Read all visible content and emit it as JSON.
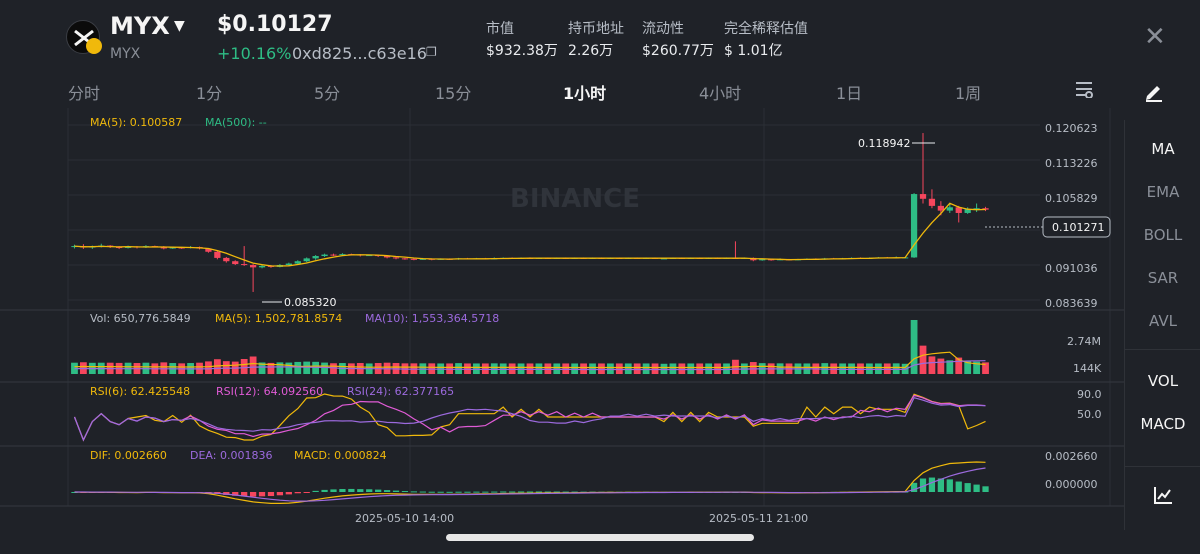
{
  "header": {
    "symbol": "MYX",
    "symbol_sub": "MYX",
    "price": "$0.10127",
    "change": "+10.16%",
    "address": "0xd825...c63e16",
    "stats": [
      {
        "label": "市值",
        "value": "$932.38万"
      },
      {
        "label": "持币地址",
        "value": "2.26万"
      },
      {
        "label": "流动性",
        "value": "$260.77万"
      },
      {
        "label": "完全稀释估值",
        "value": "$ 1.01亿"
      }
    ],
    "close_icon": "close-icon",
    "caret_icon": "chevron-down-icon",
    "copy_icon": "copy-icon"
  },
  "tabs": [
    "分时",
    "1分",
    "5分",
    "15分",
    "1小时",
    "4小时",
    "1日",
    "1周"
  ],
  "active_tab": "1小时",
  "sidebar": [
    "MA",
    "EMA",
    "BOLL",
    "SAR",
    "AVL",
    "VOL",
    "MACD"
  ],
  "sidebar_active": [
    "MA",
    "VOL",
    "MACD"
  ],
  "chart_data": {
    "type": "candlestick",
    "watermark": "BINANCE",
    "price_axis": [
      "0.120623",
      "0.113226",
      "0.105829",
      "0.101271",
      "0.091036",
      "0.083639"
    ],
    "current_price": "0.101271",
    "high_label": "0.118942",
    "low_label": "0.085320",
    "ma_legend": {
      "ma5": "MA(5): 0.100587",
      "ma500": "MA(500): --"
    },
    "vol_legend": {
      "vol": "Vol: 650,776.5849",
      "ma5": "MA(5): 1,502,781.8574",
      "ma10": "MA(10): 1,553,364.5718"
    },
    "vol_axis": [
      "2.74M",
      "144K"
    ],
    "rsi_legend": {
      "r6": "RSI(6): 62.425548",
      "r12": "RSI(12): 64.092560",
      "r24": "RSI(24): 62.377165"
    },
    "rsi_axis": [
      "90.0",
      "50.0"
    ],
    "macd_legend": {
      "dif": "DIF: 0.002660",
      "dea": "DEA: 0.001836",
      "macd": "MACD: 0.000824"
    },
    "macd_axis": [
      "0.002660",
      "0.000000"
    ],
    "x_labels": [
      "2025-05-10 14:00",
      "2025-05-11 21:00"
    ],
    "colors": {
      "up": "#2ebd85",
      "down": "#f6465d",
      "ma5": "#f0b90b",
      "ma10": "#9c6ade",
      "grid": "#2b2f36"
    },
    "candles": [
      [
        0.0948,
        0.095,
        0.0945,
        0.0953
      ],
      [
        0.095,
        0.0947,
        0.0944,
        0.0954
      ],
      [
        0.0947,
        0.0949,
        0.0944,
        0.0951
      ],
      [
        0.0949,
        0.0951,
        0.0947,
        0.0955
      ],
      [
        0.0951,
        0.0948,
        0.0946,
        0.0952
      ],
      [
        0.0948,
        0.0946,
        0.0944,
        0.095
      ],
      [
        0.0946,
        0.0949,
        0.0945,
        0.0951
      ],
      [
        0.0949,
        0.0947,
        0.0945,
        0.095
      ],
      [
        0.0947,
        0.095,
        0.0946,
        0.0952
      ],
      [
        0.095,
        0.0949,
        0.0947,
        0.0951
      ],
      [
        0.0949,
        0.0945,
        0.0943,
        0.095
      ],
      [
        0.0945,
        0.0947,
        0.0944,
        0.0949
      ],
      [
        0.0947,
        0.0946,
        0.0944,
        0.0948
      ],
      [
        0.0946,
        0.0948,
        0.0945,
        0.095
      ],
      [
        0.0948,
        0.0945,
        0.0943,
        0.0949
      ],
      [
        0.0945,
        0.0938,
        0.0936,
        0.0946
      ],
      [
        0.0938,
        0.0925,
        0.0922,
        0.094
      ],
      [
        0.0925,
        0.0918,
        0.0915,
        0.0927
      ],
      [
        0.0918,
        0.0912,
        0.091,
        0.092
      ],
      [
        0.0912,
        0.091,
        0.0908,
        0.095
      ],
      [
        0.091,
        0.0905,
        0.0853,
        0.0912
      ],
      [
        0.0905,
        0.0908,
        0.0903,
        0.0911
      ],
      [
        0.0908,
        0.0906,
        0.0904,
        0.091
      ],
      [
        0.0906,
        0.091,
        0.0905,
        0.0912
      ],
      [
        0.091,
        0.0913,
        0.0908,
        0.0915
      ],
      [
        0.0913,
        0.0918,
        0.0911,
        0.092
      ],
      [
        0.0918,
        0.0924,
        0.0916,
        0.0926
      ],
      [
        0.0924,
        0.0929,
        0.0921,
        0.0931
      ],
      [
        0.0929,
        0.0932,
        0.0927,
        0.0934
      ],
      [
        0.0932,
        0.0931,
        0.0929,
        0.0934
      ],
      [
        0.0931,
        0.0933,
        0.093,
        0.0935
      ],
      [
        0.0933,
        0.0932,
        0.093,
        0.0934
      ],
      [
        0.0932,
        0.093,
        0.0928,
        0.0933
      ],
      [
        0.093,
        0.0931,
        0.0929,
        0.0932
      ],
      [
        0.0931,
        0.0929,
        0.0927,
        0.0932
      ],
      [
        0.0929,
        0.0926,
        0.0924,
        0.093
      ],
      [
        0.0926,
        0.0924,
        0.0922,
        0.0927
      ],
      [
        0.0924,
        0.0923,
        0.0921,
        0.0925
      ],
      [
        0.0923,
        0.0922,
        0.092,
        0.0924
      ],
      [
        0.0922,
        0.0923,
        0.0921,
        0.0925
      ],
      [
        0.0923,
        0.0922,
        0.092,
        0.0924
      ],
      [
        0.0922,
        0.0923,
        0.0921,
        0.0924
      ],
      [
        0.0923,
        0.0922,
        0.0921,
        0.0924
      ],
      [
        0.0922,
        0.0924,
        0.0921,
        0.0925
      ],
      [
        0.0924,
        0.0923,
        0.0922,
        0.0925
      ],
      [
        0.0923,
        0.0924,
        0.0922,
        0.0925
      ],
      [
        0.0924,
        0.0923,
        0.0922,
        0.0925
      ],
      [
        0.0923,
        0.0924,
        0.0922,
        0.0926
      ],
      [
        0.0924,
        0.0925,
        0.0923,
        0.0926
      ],
      [
        0.0925,
        0.0924,
        0.0923,
        0.0926
      ],
      [
        0.0924,
        0.0925,
        0.0923,
        0.0926
      ],
      [
        0.0925,
        0.0924,
        0.0923,
        0.0926
      ],
      [
        0.0924,
        0.0925,
        0.0923,
        0.0926
      ],
      [
        0.0925,
        0.0924,
        0.0923,
        0.0926
      ],
      [
        0.0924,
        0.0925,
        0.0923,
        0.0926
      ],
      [
        0.0925,
        0.0924,
        0.0923,
        0.0926
      ],
      [
        0.0924,
        0.0925,
        0.0923,
        0.0926
      ],
      [
        0.0925,
        0.0924,
        0.0923,
        0.0926
      ],
      [
        0.0924,
        0.0925,
        0.0923,
        0.0926
      ],
      [
        0.0925,
        0.0924,
        0.0923,
        0.0926
      ],
      [
        0.0924,
        0.0925,
        0.0923,
        0.0926
      ],
      [
        0.0925,
        0.0924,
        0.0923,
        0.0926
      ],
      [
        0.0924,
        0.0925,
        0.0923,
        0.0926
      ],
      [
        0.0925,
        0.0924,
        0.0923,
        0.0926
      ],
      [
        0.0924,
        0.0925,
        0.0923,
        0.0926
      ],
      [
        0.0925,
        0.0924,
        0.0923,
        0.0926
      ],
      [
        0.0924,
        0.0924,
        0.0923,
        0.0925
      ],
      [
        0.0924,
        0.0925,
        0.0923,
        0.0926
      ],
      [
        0.0925,
        0.0924,
        0.0923,
        0.0926
      ],
      [
        0.0924,
        0.0925,
        0.0923,
        0.0926
      ],
      [
        0.0925,
        0.0924,
        0.0923,
        0.0926
      ],
      [
        0.0924,
        0.0925,
        0.0923,
        0.0926
      ],
      [
        0.0925,
        0.0924,
        0.0923,
        0.0926
      ],
      [
        0.0924,
        0.0925,
        0.0923,
        0.0926
      ],
      [
        0.0925,
        0.0924,
        0.0923,
        0.096
      ],
      [
        0.0924,
        0.0925,
        0.0923,
        0.0926
      ],
      [
        0.0925,
        0.092,
        0.0918,
        0.0926
      ],
      [
        0.092,
        0.0922,
        0.0919,
        0.0923
      ],
      [
        0.0922,
        0.0921,
        0.0919,
        0.0923
      ],
      [
        0.0921,
        0.0922,
        0.092,
        0.0924
      ],
      [
        0.0922,
        0.0921,
        0.092,
        0.0923
      ],
      [
        0.0921,
        0.0922,
        0.092,
        0.0923
      ],
      [
        0.0922,
        0.0923,
        0.0921,
        0.0924
      ],
      [
        0.0923,
        0.0922,
        0.0921,
        0.0924
      ],
      [
        0.0922,
        0.0924,
        0.0921,
        0.0925
      ],
      [
        0.0924,
        0.0923,
        0.0922,
        0.0925
      ],
      [
        0.0923,
        0.0924,
        0.0922,
        0.0925
      ],
      [
        0.0924,
        0.0925,
        0.0923,
        0.0926
      ],
      [
        0.0925,
        0.0924,
        0.0923,
        0.0926
      ],
      [
        0.0924,
        0.0925,
        0.0923,
        0.0926
      ],
      [
        0.0925,
        0.0926,
        0.0924,
        0.0927
      ],
      [
        0.0926,
        0.0925,
        0.0924,
        0.0927
      ],
      [
        0.0925,
        0.0926,
        0.0924,
        0.0928
      ],
      [
        0.0926,
        0.0926,
        0.0925,
        0.0927
      ],
      [
        0.0926,
        0.106,
        0.0925,
        0.1062
      ],
      [
        0.106,
        0.105,
        0.104,
        0.1189
      ],
      [
        0.105,
        0.1035,
        0.103,
        0.107
      ],
      [
        0.1035,
        0.1025,
        0.1015,
        0.1045
      ],
      [
        0.1025,
        0.1032,
        0.102,
        0.104
      ],
      [
        0.1032,
        0.102,
        0.1,
        0.1035
      ],
      [
        0.102,
        0.1028,
        0.1018,
        0.1032
      ],
      [
        0.1028,
        0.103,
        0.1022,
        0.104
      ],
      [
        0.103,
        0.1027,
        0.1024,
        0.1033
      ]
    ]
  }
}
